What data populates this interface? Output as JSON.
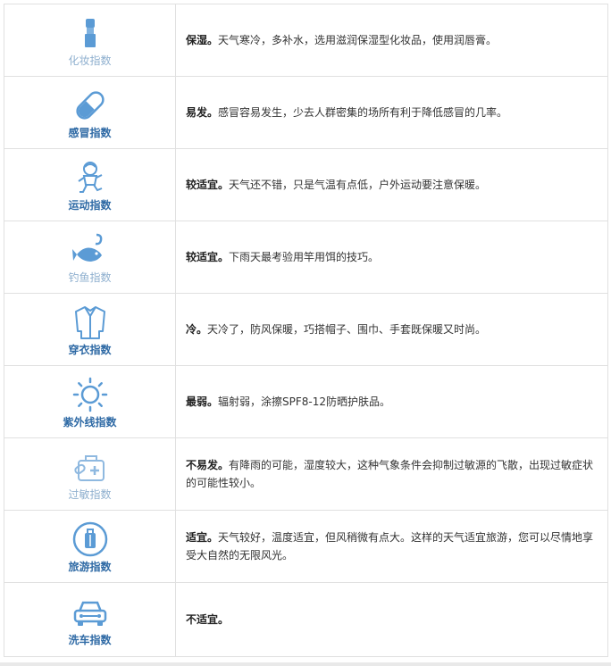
{
  "accent_color": "#5b9bd5",
  "rows": [
    {
      "icon": "lipstick-icon",
      "label": "化妆指数",
      "label_bold": false,
      "level": "保湿。",
      "text": "天气寒冷，多补水，选用滋润保湿型化妆品，使用润唇膏。"
    },
    {
      "icon": "pill-icon",
      "label": "感冒指数",
      "label_bold": true,
      "level": "易发。",
      "text": "感冒容易发生，少去人群密集的场所有利于降低感冒的几率。"
    },
    {
      "icon": "runner-icon",
      "label": "运动指数",
      "label_bold": true,
      "level": "较适宜。",
      "text": "天气还不错，只是气温有点低，户外运动要注意保暖。"
    },
    {
      "icon": "fish-hook-icon",
      "label": "钓鱼指数",
      "label_bold": false,
      "level": "较适宜。",
      "text": "下雨天最考验用竿用饵的技巧。"
    },
    {
      "icon": "shirt-icon",
      "label": "穿衣指数",
      "label_bold": true,
      "level": "冷。",
      "text": "天冷了，防风保暖，巧搭帽子、围巾、手套既保暖又时尚。"
    },
    {
      "icon": "sun-icon",
      "label": "紫外线指数",
      "label_bold": true,
      "level": "最弱。",
      "text": "辐射弱，涂擦SPF8-12防晒护肤品。"
    },
    {
      "icon": "medical-kit-icon",
      "label": "过敏指数",
      "label_bold": false,
      "level": "不易发。",
      "text": "有降雨的可能，湿度较大，这种气象条件会抑制过敏源的飞散，出现过敏症状的可能性较小。"
    },
    {
      "icon": "luggage-icon",
      "label": "旅游指数",
      "label_bold": true,
      "level": "适宜。",
      "text": "天气较好，温度适宜，但风稍微有点大。这样的天气适宜旅游，您可以尽情地享受大自然的无限风光。"
    },
    {
      "icon": "car-icon",
      "label": "洗车指数",
      "label_bold": true,
      "level": "不适宜。",
      "text": ""
    }
  ]
}
